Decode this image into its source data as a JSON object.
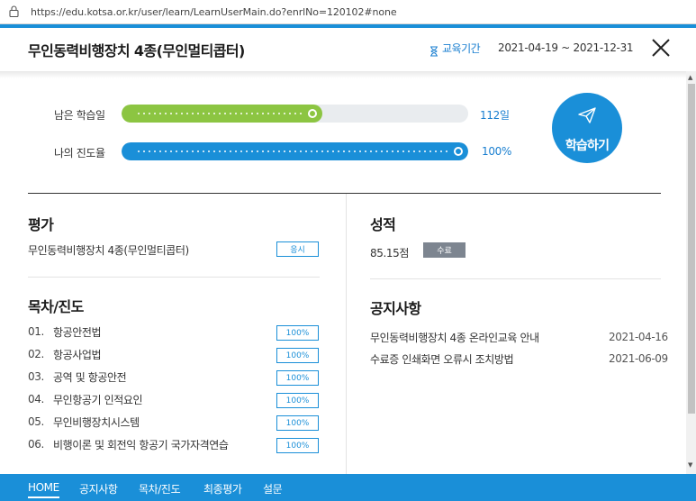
{
  "browser": {
    "url": "https://edu.kotsa.or.kr/user/learn/LearnUserMain.do?enrlNo=120102#none"
  },
  "header": {
    "title": "무인동력비행장치 4종(무인멀티콥터)",
    "period_label": "교육기간",
    "period_dates": "2021-04-19 ~ 2021-12-31"
  },
  "progress": {
    "remaining": {
      "label": "남은 학습일",
      "value": "112일",
      "fraction": 0.58
    },
    "mine": {
      "label": "나의 진도율",
      "value": "100%",
      "fraction": 1.0
    }
  },
  "study_button": {
    "label": "학습하기"
  },
  "evaluation": {
    "title": "평가",
    "item": "무인동력비행장치 4종(무인멀티콥터)",
    "action": "응시"
  },
  "grade": {
    "title": "성적",
    "score": "85.15점",
    "status": "수료"
  },
  "chapters": {
    "title": "목차/진도",
    "items": [
      {
        "num": "01.",
        "title": "항공안전법",
        "progress": "100%"
      },
      {
        "num": "02.",
        "title": "항공사업법",
        "progress": "100%"
      },
      {
        "num": "03.",
        "title": "공역 및 항공안전",
        "progress": "100%"
      },
      {
        "num": "04.",
        "title": "무인항공기 인적요인",
        "progress": "100%"
      },
      {
        "num": "05.",
        "title": "무인비행장치시스템",
        "progress": "100%"
      },
      {
        "num": "06.",
        "title": "비행이론 및 회전익 항공기 국가자격연습",
        "progress": "100%"
      }
    ]
  },
  "notices": {
    "title": "공지사항",
    "items": [
      {
        "title": "무인동력비행장치 4종 온라인교육 안내",
        "date": "2021-04-16"
      },
      {
        "title": "수료증 인쇄화면 오류시 조치방법",
        "date": "2021-06-09"
      }
    ]
  },
  "nav": {
    "items": [
      "HOME",
      "공지사항",
      "목차/진도",
      "최종평가",
      "설문"
    ]
  },
  "colors": {
    "accent": "#1a8fd8",
    "green": "#8cc542",
    "status_gray": "#7d8590"
  }
}
